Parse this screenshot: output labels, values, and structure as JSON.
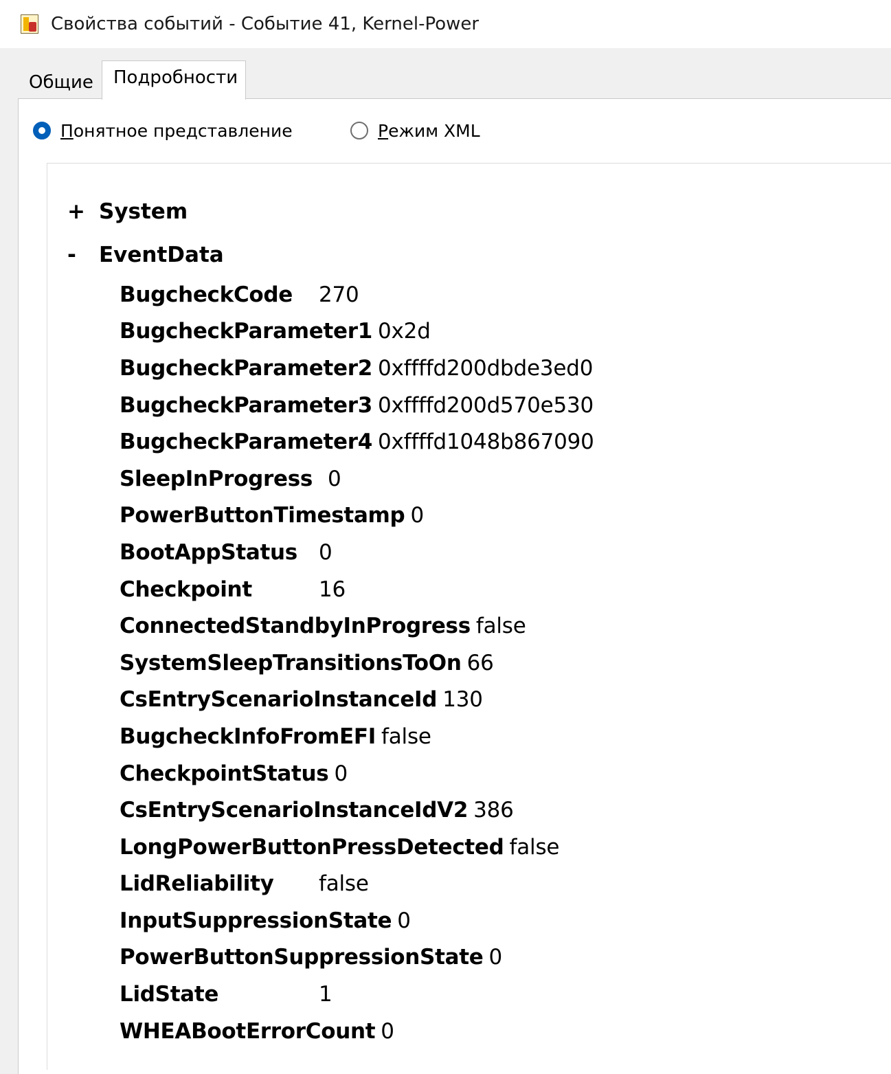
{
  "window": {
    "title": "Свойства событий - Событие 41, Kernel-Power",
    "icon": "event-viewer-icon"
  },
  "tabs": [
    {
      "label": "Общие",
      "active": false
    },
    {
      "label": "Подробности",
      "active": true
    }
  ],
  "view_mode": {
    "friendly_label": "Понятное представление",
    "xml_label": "Режим XML",
    "selected": "friendly"
  },
  "tree": {
    "system": {
      "toggle": "+",
      "label": "System"
    },
    "eventdata": {
      "toggle": "-",
      "label": "EventData"
    }
  },
  "event_data": [
    {
      "key": "BugcheckCode",
      "value": "270"
    },
    {
      "key": "BugcheckParameter1",
      "value": "0x2d"
    },
    {
      "key": "BugcheckParameter2",
      "value": "0xffffd200dbde3ed0"
    },
    {
      "key": "BugcheckParameter3",
      "value": "0xffffd200d570e530"
    },
    {
      "key": "BugcheckParameter4",
      "value": "0xffffd1048b867090"
    },
    {
      "key": "SleepInProgress",
      "value": "0"
    },
    {
      "key": "PowerButtonTimestamp",
      "value": "0"
    },
    {
      "key": "BootAppStatus",
      "value": "0"
    },
    {
      "key": "Checkpoint",
      "value": "16"
    },
    {
      "key": "ConnectedStandbyInProgress",
      "value": "false"
    },
    {
      "key": "SystemSleepTransitionsToOn",
      "value": "66"
    },
    {
      "key": "CsEntryScenarioInstanceId",
      "value": "130"
    },
    {
      "key": "BugcheckInfoFromEFI",
      "value": "false"
    },
    {
      "key": "CheckpointStatus",
      "value": "0"
    },
    {
      "key": "CsEntryScenarioInstanceIdV2",
      "value": "386"
    },
    {
      "key": "LongPowerButtonPressDetected",
      "value": "false"
    },
    {
      "key": "LidReliability",
      "value": "false"
    },
    {
      "key": "InputSuppressionState",
      "value": "0"
    },
    {
      "key": "PowerButtonSuppressionState",
      "value": "0"
    },
    {
      "key": "LidState",
      "value": "1"
    },
    {
      "key": "WHEABootErrorCount",
      "value": "0"
    }
  ],
  "colors": {
    "accent": "#005fb8",
    "window_bg": "#f0f0f0",
    "content_bg": "#ffffff"
  }
}
